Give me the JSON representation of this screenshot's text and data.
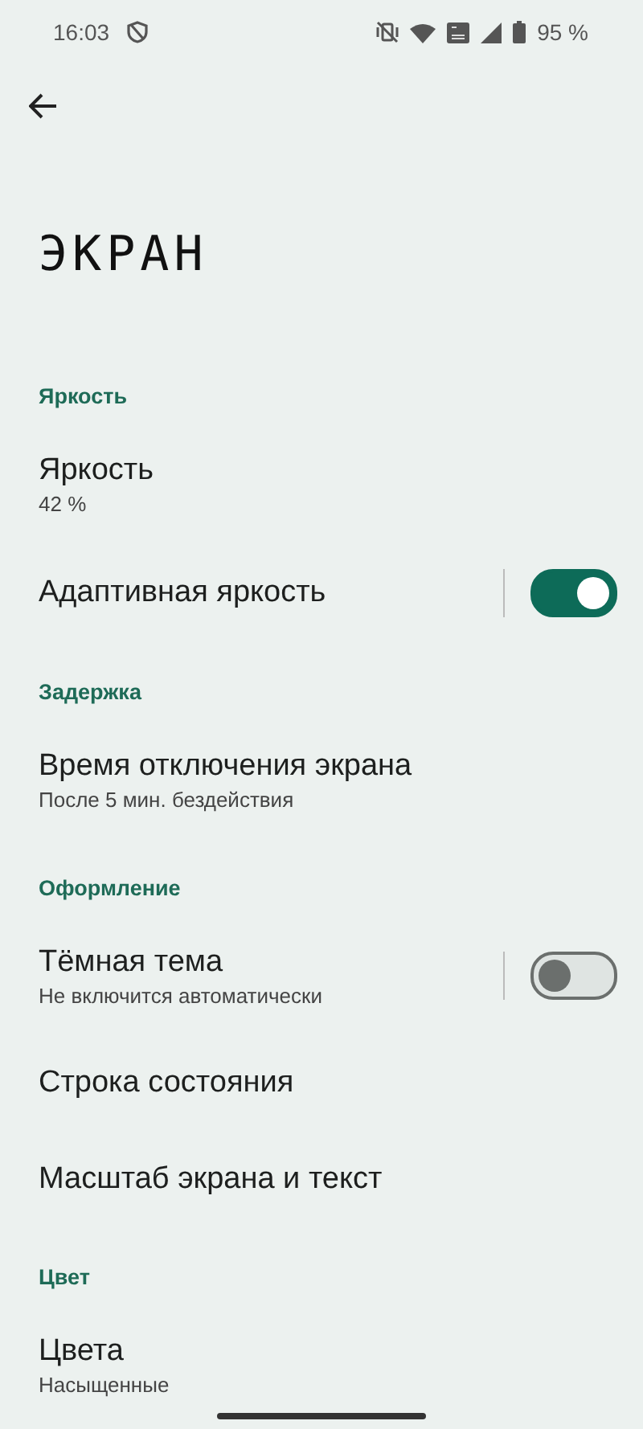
{
  "status_bar": {
    "time": "16:03",
    "battery": "95 %"
  },
  "title": "ЭКРАН",
  "sections": [
    {
      "header": "Яркость",
      "items": [
        {
          "kind": "text",
          "title": "Яркость",
          "subtitle": "42 %"
        },
        {
          "kind": "toggle",
          "title": "Адаптивная яркость",
          "on": true
        }
      ]
    },
    {
      "header": "Задержка",
      "items": [
        {
          "kind": "text",
          "title": "Время отключения экрана",
          "subtitle": "После 5 мин. бездействия"
        }
      ]
    },
    {
      "header": "Оформление",
      "items": [
        {
          "kind": "toggle",
          "title": "Тёмная тема",
          "subtitle": "Не включится автоматически",
          "on": false
        },
        {
          "kind": "text",
          "title": "Строка состояния"
        },
        {
          "kind": "text",
          "title": "Масштаб экрана и текст"
        }
      ]
    },
    {
      "header": "Цвет",
      "items": [
        {
          "kind": "text",
          "title": "Цвета",
          "subtitle": "Насыщенные"
        }
      ]
    }
  ]
}
